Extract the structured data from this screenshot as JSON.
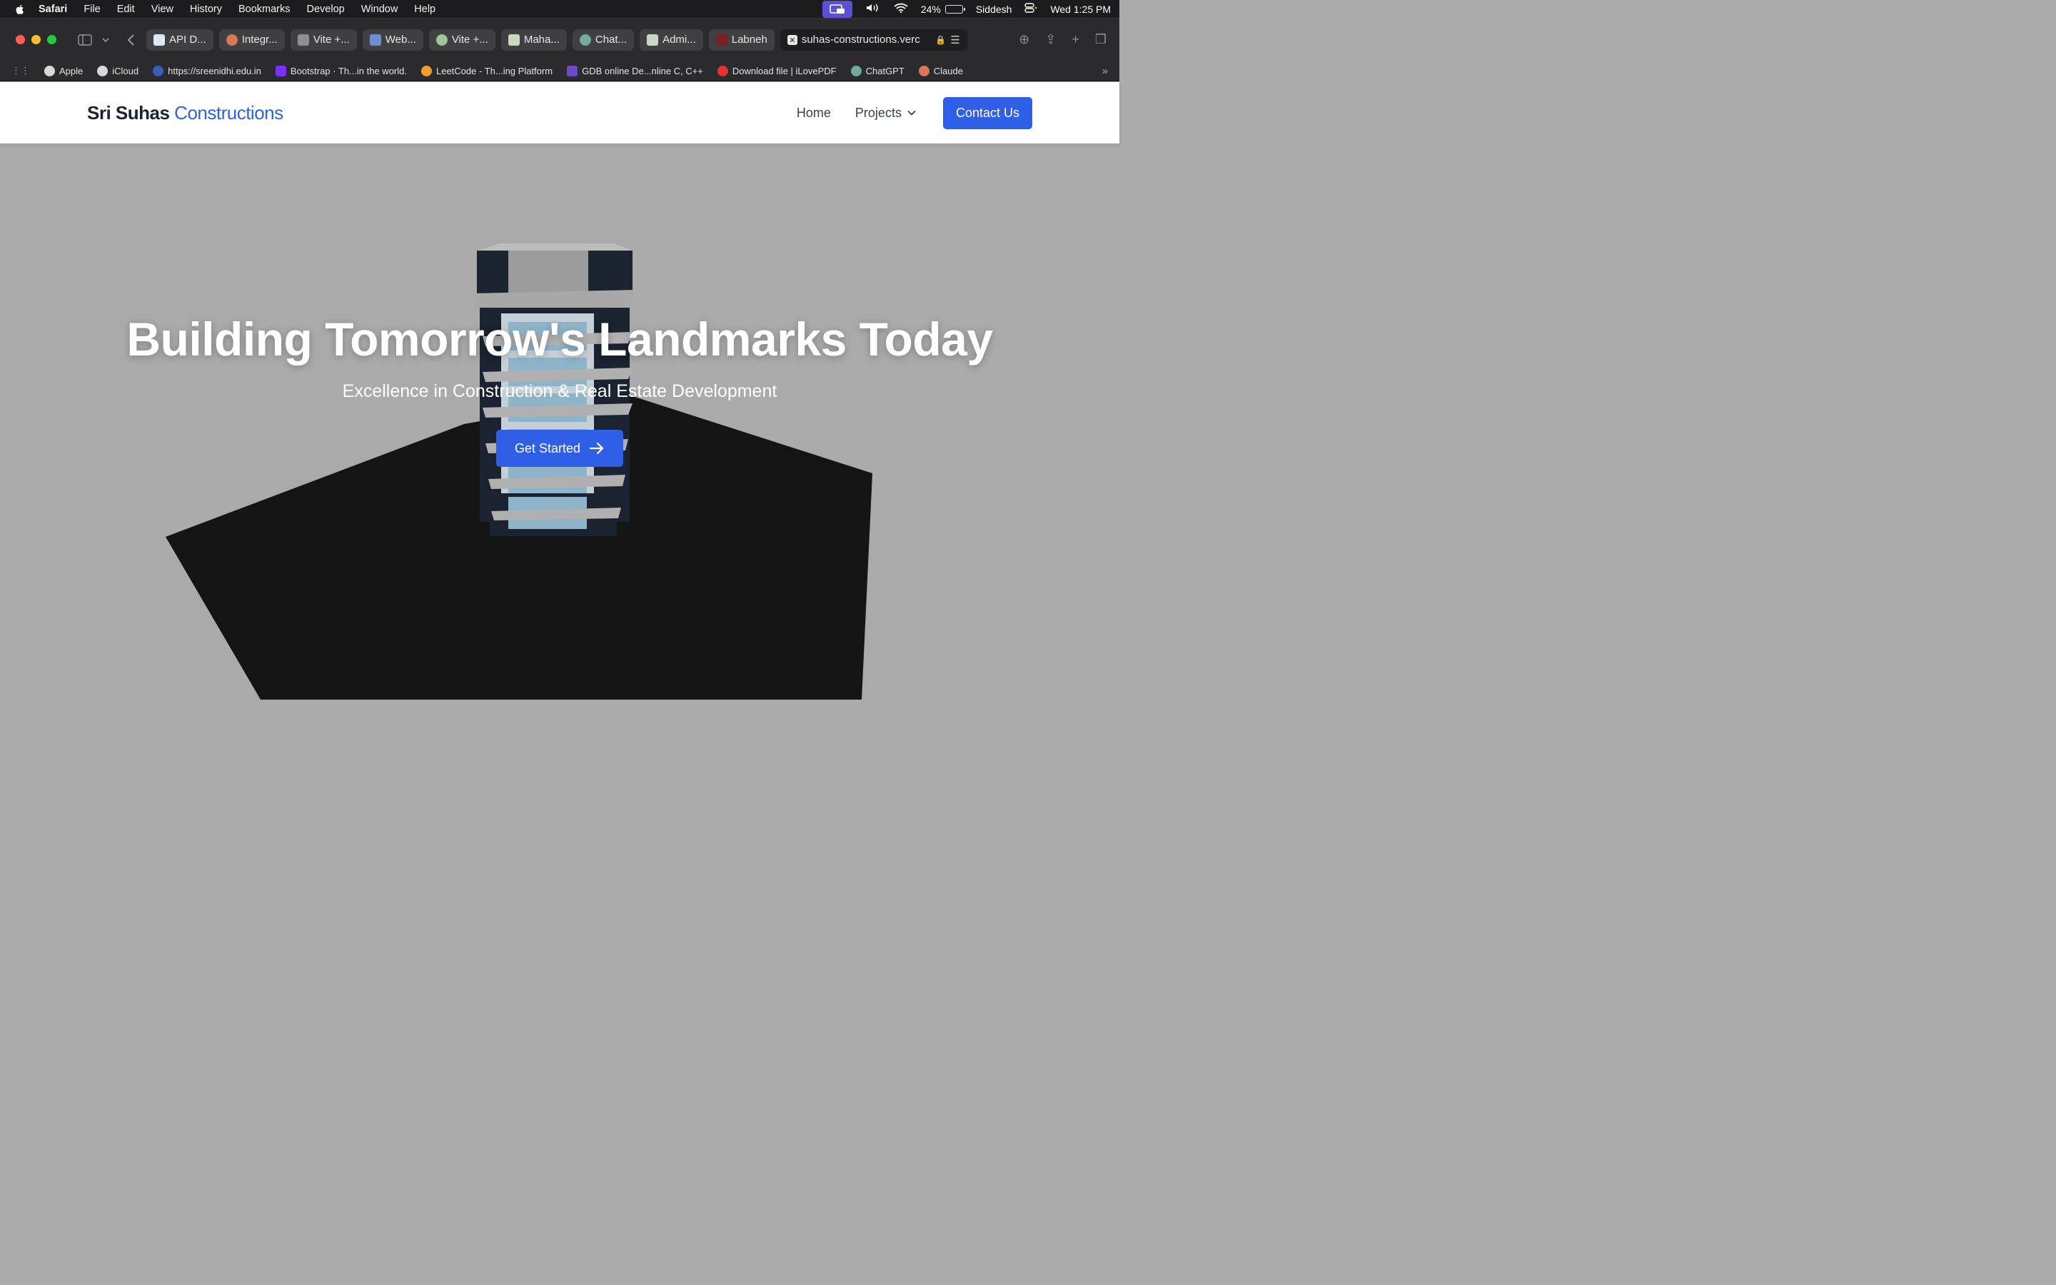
{
  "menubar": {
    "app": "Safari",
    "items": [
      "File",
      "Edit",
      "View",
      "History",
      "Bookmarks",
      "Develop",
      "Window",
      "Help"
    ],
    "battery": "24%",
    "user": "Siddesh",
    "clock": "Wed 1:25 PM"
  },
  "tabs": [
    {
      "label": "API D...",
      "icon": "document-icon",
      "color": "#dfe6f5"
    },
    {
      "label": "Integr...",
      "icon": "claude-icon",
      "color": "#d97757"
    },
    {
      "label": "Vite +...",
      "icon": "v-icon",
      "color": "#8e8e93"
    },
    {
      "label": "Web...",
      "icon": "people-icon",
      "color": "#6b8fd6"
    },
    {
      "label": "Vite +...",
      "icon": "tree-icon",
      "color": "#9fc49a"
    },
    {
      "label": "Maha...",
      "icon": "logo-icon",
      "color": "#c7d9c2"
    },
    {
      "label": "Chat...",
      "icon": "chatgpt-icon",
      "color": "#74aa9c"
    },
    {
      "label": "Admi...",
      "icon": "logo-icon",
      "color": "#c7d9c2"
    },
    {
      "label": "Labneh",
      "icon": "labneh-icon",
      "color": "#7a2020"
    }
  ],
  "active_tab": {
    "url": "suhas-constructions.verc"
  },
  "bookmarks": [
    {
      "label": "Apple",
      "color": "#d8d8d8"
    },
    {
      "label": "iCloud",
      "color": "#d8d8d8"
    },
    {
      "label": "https://sreenidhi.edu.in",
      "color": "#3b5bb5"
    },
    {
      "label": "Bootstrap · Th...in the world.",
      "color": "#7b2ff7"
    },
    {
      "label": "LeetCode - Th...ing Platform",
      "color": "#f0a030"
    },
    {
      "label": "GDB online De...nline C, C++",
      "color": "#6a4bc4"
    },
    {
      "label": "Download file | iLovePDF",
      "color": "#e5322d"
    },
    {
      "label": "ChatGPT",
      "color": "#74aa9c"
    },
    {
      "label": "Claude",
      "color": "#d97757"
    }
  ],
  "site": {
    "brand_bold": "Sri Suhas",
    "brand_light": "Constructions",
    "nav_home": "Home",
    "nav_projects": "Projects",
    "contact": "Contact Us"
  },
  "hero": {
    "title": "Building Tomorrow's Landmarks Today",
    "subtitle": "Excellence in Construction & Real Estate Development",
    "cta": "Get Started"
  },
  "colors": {
    "accent": "#2f5fe6",
    "brand_dark": "#1b2333",
    "hero_bg": "#aaaaaa"
  }
}
